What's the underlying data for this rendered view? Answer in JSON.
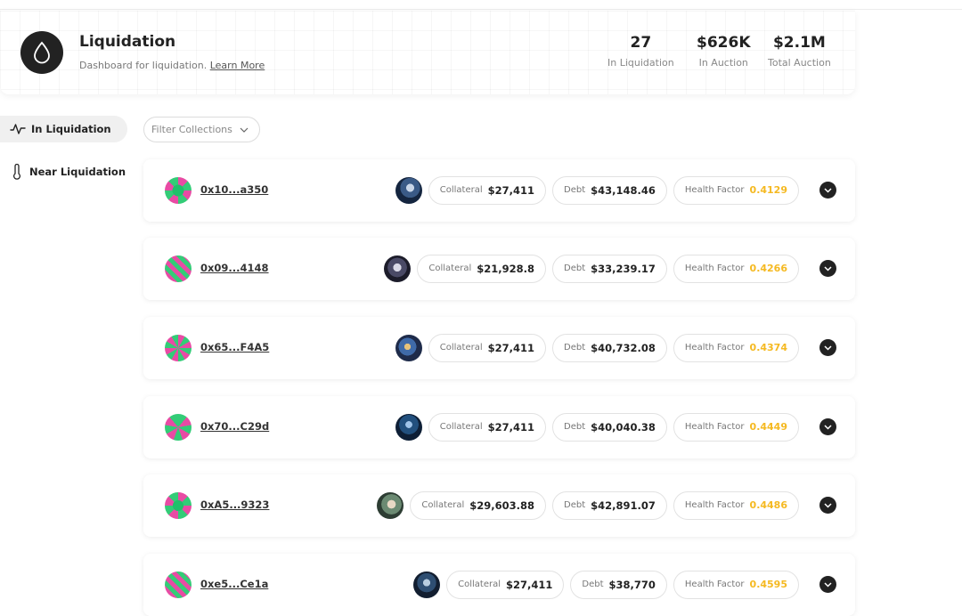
{
  "header": {
    "title": "Liquidation",
    "subtitle": "Dashboard for liquidation.",
    "learn_more": "Learn More",
    "stats": [
      {
        "value": "27",
        "label": "In Liquidation"
      },
      {
        "value": "$626K",
        "label": "In Auction"
      },
      {
        "value": "$2.1M",
        "label": "Total Auction"
      }
    ]
  },
  "sidebar": {
    "items": [
      {
        "label": "In Liquidation",
        "icon": "activity-icon",
        "active": true
      },
      {
        "label": "Near Liquidation",
        "icon": "thermometer-icon",
        "active": false
      }
    ]
  },
  "filter": {
    "label": "Filter Collections"
  },
  "labels": {
    "collateral": "Collateral",
    "debt": "Debt",
    "health_factor": "Health Factor"
  },
  "colors": {
    "health_factor": "#f5b921",
    "dark": "#222222"
  },
  "rows": [
    {
      "address": "0x10...a350",
      "collateral": "$27,411",
      "debt": "$43,148.46",
      "health_factor": "0.4129"
    },
    {
      "address": "0x09...4148",
      "collateral": "$21,928.8",
      "debt": "$33,239.17",
      "health_factor": "0.4266"
    },
    {
      "address": "0x65...F4A5",
      "collateral": "$27,411",
      "debt": "$40,732.08",
      "health_factor": "0.4374"
    },
    {
      "address": "0x70...C29d",
      "collateral": "$27,411",
      "debt": "$40,040.38",
      "health_factor": "0.4449"
    },
    {
      "address": "0xA5...9323",
      "collateral": "$29,603.88",
      "debt": "$42,891.07",
      "health_factor": "0.4486"
    },
    {
      "address": "0xe5...Ce1a",
      "collateral": "$27,411",
      "debt": "$38,770",
      "health_factor": "0.4595"
    }
  ]
}
